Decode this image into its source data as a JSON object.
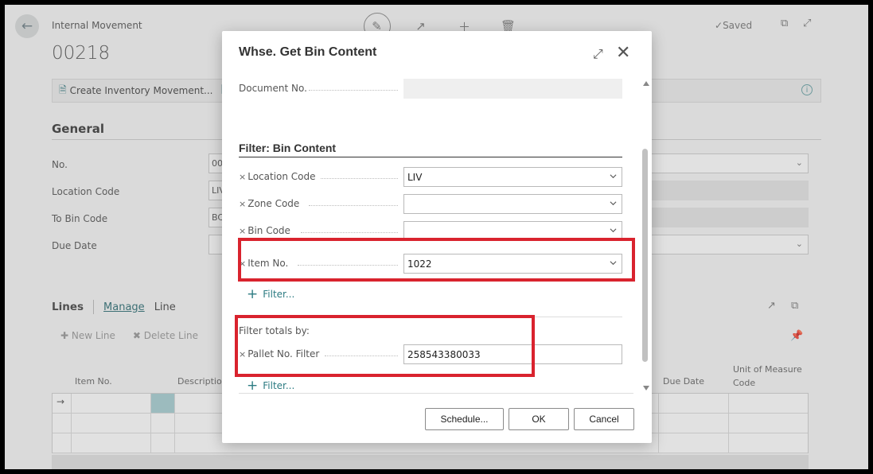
{
  "page": {
    "breadcrumb": "Internal Movement",
    "doc_no": "00218",
    "saved": "Saved",
    "create_inv_movement": "Create Inventory Movement...",
    "general_title": "General",
    "fields": [
      {
        "label": "No.",
        "value": "00"
      },
      {
        "label": "Location Code",
        "value": "LIV"
      },
      {
        "label": "To Bin Code",
        "value": "BC"
      },
      {
        "label": "Due Date",
        "value": ""
      }
    ],
    "lines": {
      "title": "Lines",
      "manage": "Manage",
      "line": "Line",
      "new_line": "New Line",
      "delete_line": "Delete Line",
      "columns": {
        "item_no": "Item No.",
        "description": "Description",
        "due_date": "Due Date",
        "uom_line1": "Unit of Measure",
        "uom_line2": "Code"
      }
    }
  },
  "dialog": {
    "title": "Whse. Get Bin Content",
    "document_no_label": "Document No.",
    "document_no_value": "",
    "filter_section_title": "Filter: Bin Content",
    "filters": [
      {
        "label": "Location Code",
        "value": "LIV"
      },
      {
        "label": "Zone Code",
        "value": ""
      },
      {
        "label": "Bin Code",
        "value": ""
      },
      {
        "label": "Item No.",
        "value": "1022"
      }
    ],
    "add_filter": "Filter...",
    "totals_title": "Filter totals by:",
    "pallet_filter_label": "Pallet No. Filter",
    "pallet_filter_value": "258543380033",
    "add_filter_2": "Filter...",
    "buttons": {
      "schedule": "Schedule...",
      "ok": "OK",
      "cancel": "Cancel"
    }
  },
  "colors": {
    "highlight": "#d9232e",
    "link": "#2c7b82"
  }
}
